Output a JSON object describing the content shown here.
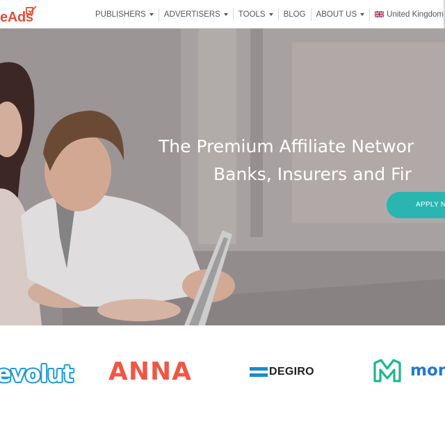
{
  "brand": {
    "logo_text": "eAds",
    "logo_color": "#e0503a"
  },
  "nav": {
    "items": [
      {
        "label": "PUBLISHERS",
        "has_caret": true
      },
      {
        "label": "ADVERTISERS",
        "has_caret": true
      },
      {
        "label": "TOOLS",
        "has_caret": true
      },
      {
        "label": "BLOG",
        "has_caret": false
      },
      {
        "label": "ABOUT US",
        "has_caret": true
      },
      {
        "label": "United Kingdom",
        "has_caret": true,
        "icon": "uk-flag-icon"
      }
    ]
  },
  "hero": {
    "title_line1": "The Premium Affiliate Networ",
    "title_line2": "Banks, Insurers and Fir",
    "cta_label": "APPLY N",
    "accent_color": "#2ab5b0"
  },
  "partners": {
    "logos": [
      {
        "name": "evolut",
        "color": "#1c97d6"
      },
      {
        "name": "ANNA",
        "color": "#ef5745"
      },
      {
        "name": "DEGIRO",
        "color": "#1a8ad1"
      },
      {
        "name": "mon",
        "color": "#2178cf"
      }
    ]
  }
}
